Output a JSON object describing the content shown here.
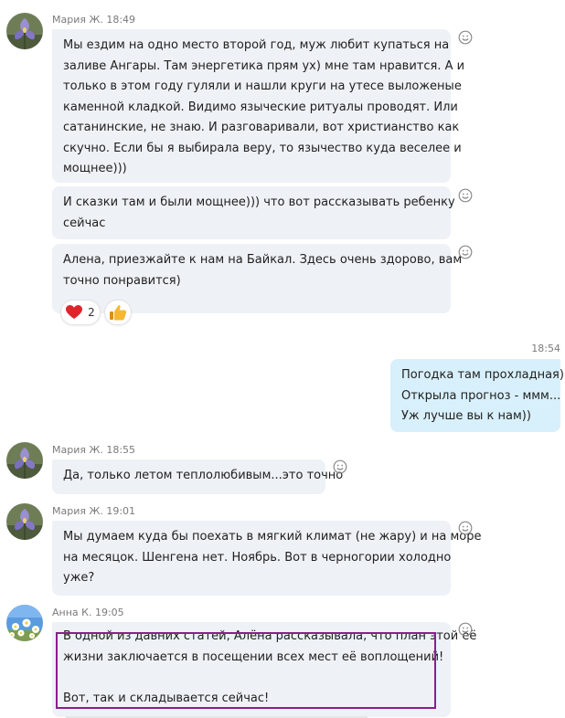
{
  "colors": {
    "incoming_bubble": "#eef1f5",
    "outgoing_bubble": "#d8f0fb",
    "meta_text": "#7b7b7b",
    "highlight_border": "#8b1e8c",
    "heart": "#e0242b",
    "thumbs_up": "#f7b731"
  },
  "icons": {
    "smile": "smile-icon",
    "heart": "heart-icon",
    "thumbs_up": "thumbs-up-icon",
    "avatar_maria": "iris-flower-avatar",
    "avatar_anna": "daisies-sky-avatar"
  },
  "messages": {
    "group1": {
      "meta": "Мария Ж. 18:49",
      "bubble1": [
        "Мы ездим на одно место второй год, муж любит купаться на",
        "заливе Ангары. Там энергетика прям ух) мне там нравится. А и",
        "только в этом году гуляли и  нашли круги на утесе выложеные",
        "каменной кладкой. Видимо языческие ритуалы проводят. Или",
        "сатанинские, не знаю. И разговаривали, вот христианство как",
        "скучно. Если бы я выбирала веру, то язычество куда веселее и",
        "мощнее)))"
      ],
      "bubble2": [
        "И сказки там и были мощнее))) что вот рассказывать ребенку",
        "сейчас"
      ],
      "bubble3": [
        "Алена, приезжайте к нам на Байкал. Здесь очень здорово, вам",
        "точно понравится)"
      ],
      "reactions": {
        "heart_count": "2"
      }
    },
    "own": {
      "time": "18:54",
      "lines": [
        "Погодка там прохладная))",
        "Открыла прогноз - ммм...",
        "Уж лучше вы к нам))"
      ]
    },
    "group2": {
      "meta": "Мария Ж. 18:55",
      "lines": [
        "Да, только летом теплолюбивым...это точно"
      ]
    },
    "group3": {
      "meta": "Мария Ж. 19:01",
      "lines": [
        "Мы думаем куда бы поехать в мягкий климат (не жару) и на море",
        "на месяцок. Шенгена нет. Ноябрь. Вот в черногории  холодно",
        "уже?"
      ]
    },
    "group4": {
      "meta": "Анна К. 19:05",
      "lines": [
        "В одной из давних статей, Алёна рассказывала, что план этой её",
        "жизни заключается в посещении всех мест её воплощений!",
        "",
        "Вот, так и складывается сейчас!"
      ]
    }
  }
}
